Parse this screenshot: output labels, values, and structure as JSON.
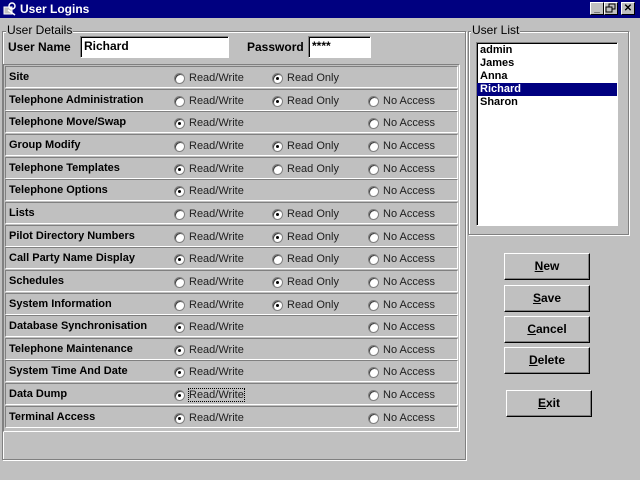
{
  "window": {
    "title": "User Logins"
  },
  "user_details": {
    "group_label": "User Details",
    "user_name_label": "User Name",
    "user_name_value": "Richard",
    "password_label": "Password",
    "password_value": "****"
  },
  "options": {
    "read_write": "Read/Write",
    "read_only": "Read Only",
    "no_access": "No Access"
  },
  "permissions": [
    {
      "label": "Site",
      "has_rw": true,
      "has_ro": true,
      "has_na": false,
      "selected": "read_only"
    },
    {
      "label": "Telephone Administration",
      "has_rw": true,
      "has_ro": true,
      "has_na": true,
      "selected": "read_only"
    },
    {
      "label": "Telephone Move/Swap",
      "has_rw": true,
      "has_ro": false,
      "has_na": true,
      "selected": "read_write"
    },
    {
      "label": "Group Modify",
      "has_rw": true,
      "has_ro": true,
      "has_na": true,
      "selected": "read_only"
    },
    {
      "label": "Telephone Templates",
      "has_rw": true,
      "has_ro": true,
      "has_na": true,
      "selected": "read_write"
    },
    {
      "label": "Telephone Options",
      "has_rw": true,
      "has_ro": false,
      "has_na": true,
      "selected": "read_write"
    },
    {
      "label": "Lists",
      "has_rw": true,
      "has_ro": true,
      "has_na": true,
      "selected": "read_only"
    },
    {
      "label": "Pilot Directory Numbers",
      "has_rw": true,
      "has_ro": true,
      "has_na": true,
      "selected": "read_only"
    },
    {
      "label": "Call Party Name Display",
      "has_rw": true,
      "has_ro": true,
      "has_na": true,
      "selected": "read_write"
    },
    {
      "label": "Schedules",
      "has_rw": true,
      "has_ro": true,
      "has_na": true,
      "selected": "read_only"
    },
    {
      "label": "System Information",
      "has_rw": true,
      "has_ro": true,
      "has_na": true,
      "selected": "read_only"
    },
    {
      "label": "Database Synchronisation",
      "has_rw": true,
      "has_ro": false,
      "has_na": true,
      "selected": "read_write"
    },
    {
      "label": "Telephone Maintenance",
      "has_rw": true,
      "has_ro": false,
      "has_na": true,
      "selected": "read_write"
    },
    {
      "label": "System Time And Date",
      "has_rw": true,
      "has_ro": false,
      "has_na": true,
      "selected": "read_write"
    },
    {
      "label": "Data Dump",
      "has_rw": true,
      "has_ro": false,
      "has_na": true,
      "selected": "read_write",
      "focused": true
    },
    {
      "label": "Terminal Access",
      "has_rw": true,
      "has_ro": false,
      "has_na": true,
      "selected": "read_write"
    }
  ],
  "user_list": {
    "group_label": "User List",
    "items": [
      "admin",
      "James",
      "Anna",
      "Richard",
      "Sharon"
    ],
    "selected": "Richard"
  },
  "buttons": {
    "new": {
      "accel": "N",
      "rest": "ew"
    },
    "save": {
      "accel": "S",
      "rest": "ave"
    },
    "cancel": {
      "accel": "C",
      "rest": "ancel"
    },
    "delete": {
      "accel": "D",
      "rest": "elete"
    },
    "exit": {
      "accel": "E",
      "rest": "xit"
    }
  },
  "colors": {
    "face": "#c0c0c0",
    "titlebar": "#000080",
    "selection": "#000080"
  }
}
